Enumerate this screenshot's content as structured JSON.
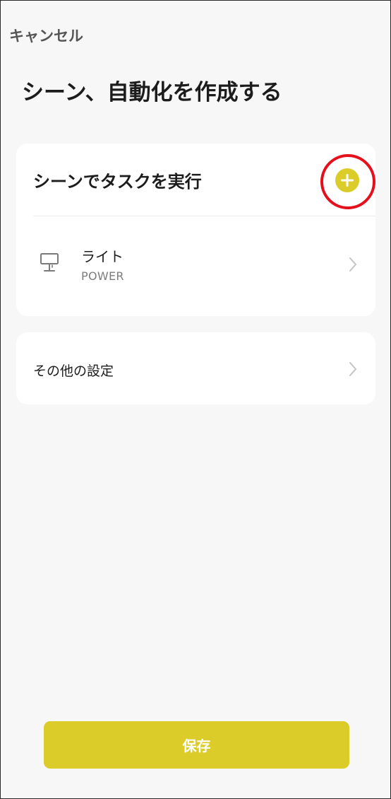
{
  "header": {
    "cancel_label": "キャンセル",
    "title": "シーン、自動化を作成する"
  },
  "tasks_section": {
    "title": "シーンでタスクを実行",
    "add_icon": "plus-circle-icon",
    "items": [
      {
        "icon": "lamp-icon",
        "name": "ライト",
        "action": "POWER"
      }
    ]
  },
  "settings_section": {
    "label": "その他の設定"
  },
  "footer": {
    "save_label": "保存"
  },
  "colors": {
    "accent": "#dccc29",
    "highlight": "#e5101b",
    "background": "#f7f7f7",
    "card": "#ffffff"
  }
}
